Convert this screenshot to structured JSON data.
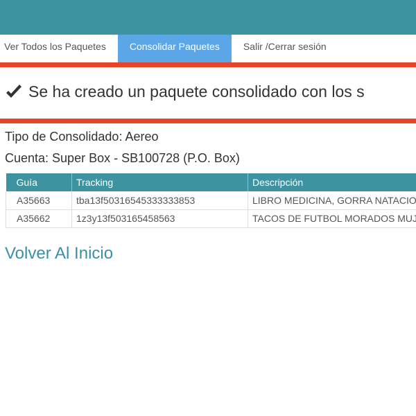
{
  "nav": {
    "items": [
      {
        "label": "Ver Todos los Paquetes"
      },
      {
        "label": "Consolidar Paquetes"
      },
      {
        "label": "Salir /Cerrar sesión"
      }
    ]
  },
  "alert": {
    "message": "Se ha creado un paquete consolidado con los s"
  },
  "info": {
    "type_line": "Tipo de Consolidado: Aereo",
    "account_line": "Cuenta: Super Box - SB100728 (P.O. Box)"
  },
  "table": {
    "headers": [
      "Guía",
      "Tracking",
      "Descripción"
    ],
    "rows": [
      [
        "A35663",
        "tba13f50316545333333853",
        "LIBRO MEDICINA, GORRA NATACIO"
      ],
      [
        "A35662",
        "1z3y13f503165458563",
        "TACOS DE FUTBOL MORADOS MUJER"
      ]
    ]
  },
  "back_link": "Volver Al Inicio",
  "colors": {
    "header_teal": "#3d939f",
    "active_tab": "#5aa6e6",
    "alert_red": "#e8442a",
    "link_blue": "#3d8ea8"
  }
}
